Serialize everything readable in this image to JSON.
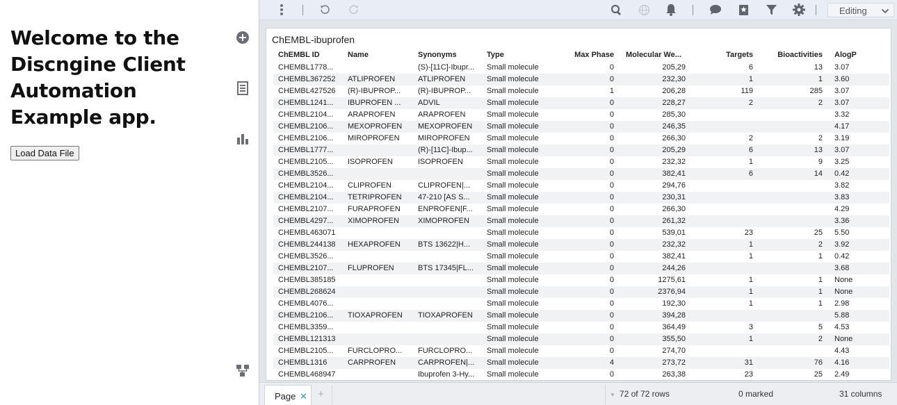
{
  "left_panel": {
    "welcome": "Welcome to the Discngine Client Automation Example app.",
    "load_button": "Load Data File"
  },
  "rail_icons": [
    "plus-circle-icon",
    "document-icon",
    "bar-chart-icon",
    "hierarchy-icon"
  ],
  "toolbar": {
    "mode": "Editing",
    "icons": [
      "vertical-dots-icon",
      "undo-icon",
      "redo-icon",
      "search-icon",
      "globe-icon",
      "bell-icon",
      "comment-icon",
      "bookmark-icon",
      "filter-icon",
      "gear-icon"
    ]
  },
  "table": {
    "title": "ChEMBL-ibuprofen",
    "columns": [
      "ChEMBL ID",
      "Name",
      "Synonyms",
      "Type",
      "Max Phase",
      "Molecular We...",
      "Targets",
      "Bioactivities",
      "AlogP"
    ],
    "rows": [
      [
        "CHEMBL1778...",
        "",
        "(S)-[11C]-Ibupr...",
        "Small molecule",
        "0",
        "205,29",
        "6",
        "13",
        "3.07"
      ],
      [
        "CHEMBL367252",
        "ATLIPROFEN",
        "ATLIPROFEN",
        "Small molecule",
        "0",
        "232,30",
        "1",
        "1",
        "3.60"
      ],
      [
        "CHEMBL427526",
        "(R)-IBUPROP...",
        "(R)-IBUPROP...",
        "Small molecule",
        "1",
        "206,28",
        "119",
        "285",
        "3.07"
      ],
      [
        "CHEMBL1241...",
        "IBUPROFEN ...",
        "ADVIL",
        "Small molecule",
        "0",
        "228,27",
        "2",
        "2",
        "3.07"
      ],
      [
        "CHEMBL2104...",
        "ARAPROFEN",
        "ARAPROFEN",
        "Small molecule",
        "0",
        "285,30",
        "",
        "",
        "3.32"
      ],
      [
        "CHEMBL2106...",
        "MEXOPROFEN",
        "MEXOPROFEN",
        "Small molecule",
        "0",
        "246,35",
        "",
        "",
        "4.17"
      ],
      [
        "CHEMBL2106...",
        "MIROPROFEN",
        "MIROPROFEN",
        "Small molecule",
        "0",
        "266,30",
        "2",
        "2",
        "3.19"
      ],
      [
        "CHEMBL1777...",
        "",
        "(R)-[11C]-Ibup...",
        "Small molecule",
        "0",
        "205,29",
        "6",
        "13",
        "3.07"
      ],
      [
        "CHEMBL2105...",
        "ISOPROFEN",
        "ISOPROFEN",
        "Small molecule",
        "0",
        "232,32",
        "1",
        "9",
        "3.25"
      ],
      [
        "CHEMBL3526...",
        "",
        "",
        "Small molecule",
        "0",
        "382,41",
        "6",
        "14",
        "0.42"
      ],
      [
        "CHEMBL2104...",
        "CLIPROFEN",
        "CLIPROFEN|...",
        "Small molecule",
        "0",
        "294,76",
        "",
        "",
        "3.82"
      ],
      [
        "CHEMBL2104...",
        "TETRIPROFEN",
        "47-210 [AS S...",
        "Small molecule",
        "0",
        "230,31",
        "",
        "",
        "3.83"
      ],
      [
        "CHEMBL2107...",
        "FURAPROFEN",
        "ENPROFEN|F...",
        "Small molecule",
        "0",
        "266,30",
        "",
        "",
        "4.29"
      ],
      [
        "CHEMBL4297...",
        "XIMOPROFEN",
        "XIMOPROFEN",
        "Small molecule",
        "0",
        "261,32",
        "",
        "",
        "3.36"
      ],
      [
        "CHEMBL463071",
        "",
        "",
        "Small molecule",
        "0",
        "539,01",
        "23",
        "25",
        "5.50"
      ],
      [
        "CHEMBL244138",
        "HEXAPROFEN",
        "BTS 13622|H...",
        "Small molecule",
        "0",
        "232,32",
        "1",
        "2",
        "3.92"
      ],
      [
        "CHEMBL3526...",
        "",
        "",
        "Small molecule",
        "0",
        "382,41",
        "1",
        "1",
        "0.42"
      ],
      [
        "CHEMBL2107...",
        "FLUPROFEN",
        "BTS 17345|FL...",
        "Small molecule",
        "0",
        "244,26",
        "",
        "",
        "3.68"
      ],
      [
        "CHEMBL385185",
        "",
        "",
        "Small molecule",
        "0",
        "1275,61",
        "1",
        "1",
        "None"
      ],
      [
        "CHEMBL268624",
        "",
        "",
        "Small molecule",
        "0",
        "2376,94",
        "1",
        "1",
        "None"
      ],
      [
        "CHEMBL4076...",
        "",
        "",
        "Small molecule",
        "0",
        "192,30",
        "1",
        "1",
        "2.98"
      ],
      [
        "CHEMBL2106...",
        "TIOXAPROFEN",
        "TIOXAPROFEN",
        "Small molecule",
        "0",
        "394,28",
        "",
        "",
        "5.88"
      ],
      [
        "CHEMBL3359...",
        "",
        "",
        "Small molecule",
        "0",
        "364,49",
        "3",
        "5",
        "4.53"
      ],
      [
        "CHEMBL121313",
        "",
        "",
        "Small molecule",
        "0",
        "355,50",
        "1",
        "2",
        "None"
      ],
      [
        "CHEMBL2105...",
        "FURCLOPRO...",
        "FURCLOPRO...",
        "Small molecule",
        "0",
        "274,70",
        "",
        "",
        "4.43"
      ],
      [
        "CHEMBL1316",
        "CARPROFEN",
        "CARPROFEN|...",
        "Small molecule",
        "4",
        "273,72",
        "31",
        "76",
        "4.16"
      ],
      [
        "CHEMBL468947",
        "",
        "Ibuprofen 3-Hy...",
        "Small molecule",
        "0",
        "263,38",
        "23",
        "25",
        "2.49"
      ]
    ]
  },
  "bottom": {
    "tab_label": "Page",
    "rows_status": "72 of 72 rows",
    "marked_status": "0 marked",
    "columns_status": "31 columns"
  }
}
